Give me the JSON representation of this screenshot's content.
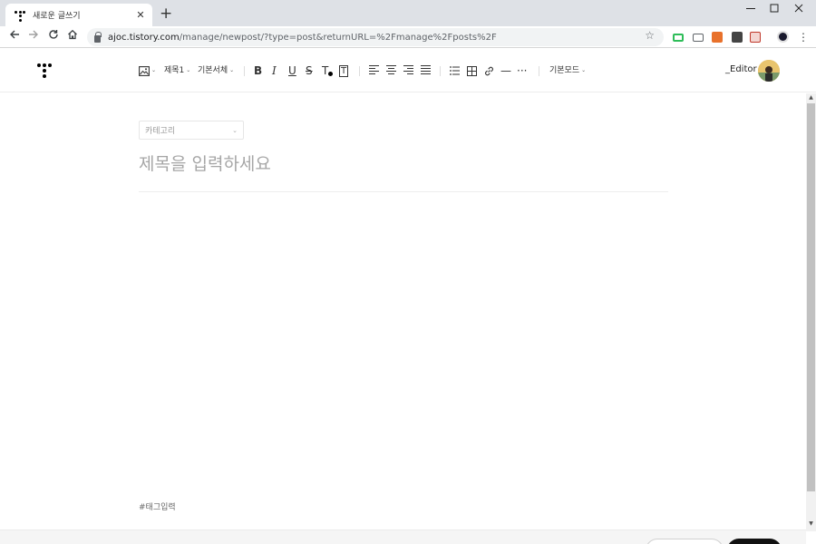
{
  "browser": {
    "tab_title": "새로운 글쓰기",
    "tab_close": "✕",
    "new_tab": "+",
    "url_host": "ajoc.tistory.com",
    "url_path": "/manage/newpost/?type=post&returnURL=%2Fmanage%2Fposts%2F",
    "window_controls": [
      "minimize-icon",
      "maximize-icon",
      "close-icon"
    ],
    "extensions": [
      {
        "name": "ext-green-icon",
        "color": "#2ebd59"
      },
      {
        "name": "ext-screen-icon",
        "color": "#5f6368"
      },
      {
        "name": "ext-fx-icon",
        "color": "#e8712b"
      },
      {
        "name": "ext-dark-icon",
        "color": "#444444"
      },
      {
        "name": "ext-pdf-icon",
        "color": "#c0392b"
      },
      {
        "name": "profile-icon",
        "color": "#1a1a2e"
      }
    ]
  },
  "toolbar": {
    "image_icon": "image-icon",
    "heading_label": "제목1",
    "font_label": "기본서체",
    "bold": "B",
    "italic": "I",
    "underline": "U",
    "strike": "S",
    "text_color": "T",
    "text_bg": "T",
    "list": "list-icon",
    "table": "table-icon",
    "link": "link-icon",
    "hr": "—",
    "more": "···",
    "mode_label": "기본모드",
    "editor_label": "_Editor"
  },
  "editor": {
    "category_label": "카테고리",
    "title_placeholder": "제목을 입력하세요",
    "tag_placeholder": "#태그입력"
  },
  "colors": {
    "toolbar_text": "#333333",
    "placeholder": "#a6a6a6",
    "publish_button": "#111111"
  }
}
